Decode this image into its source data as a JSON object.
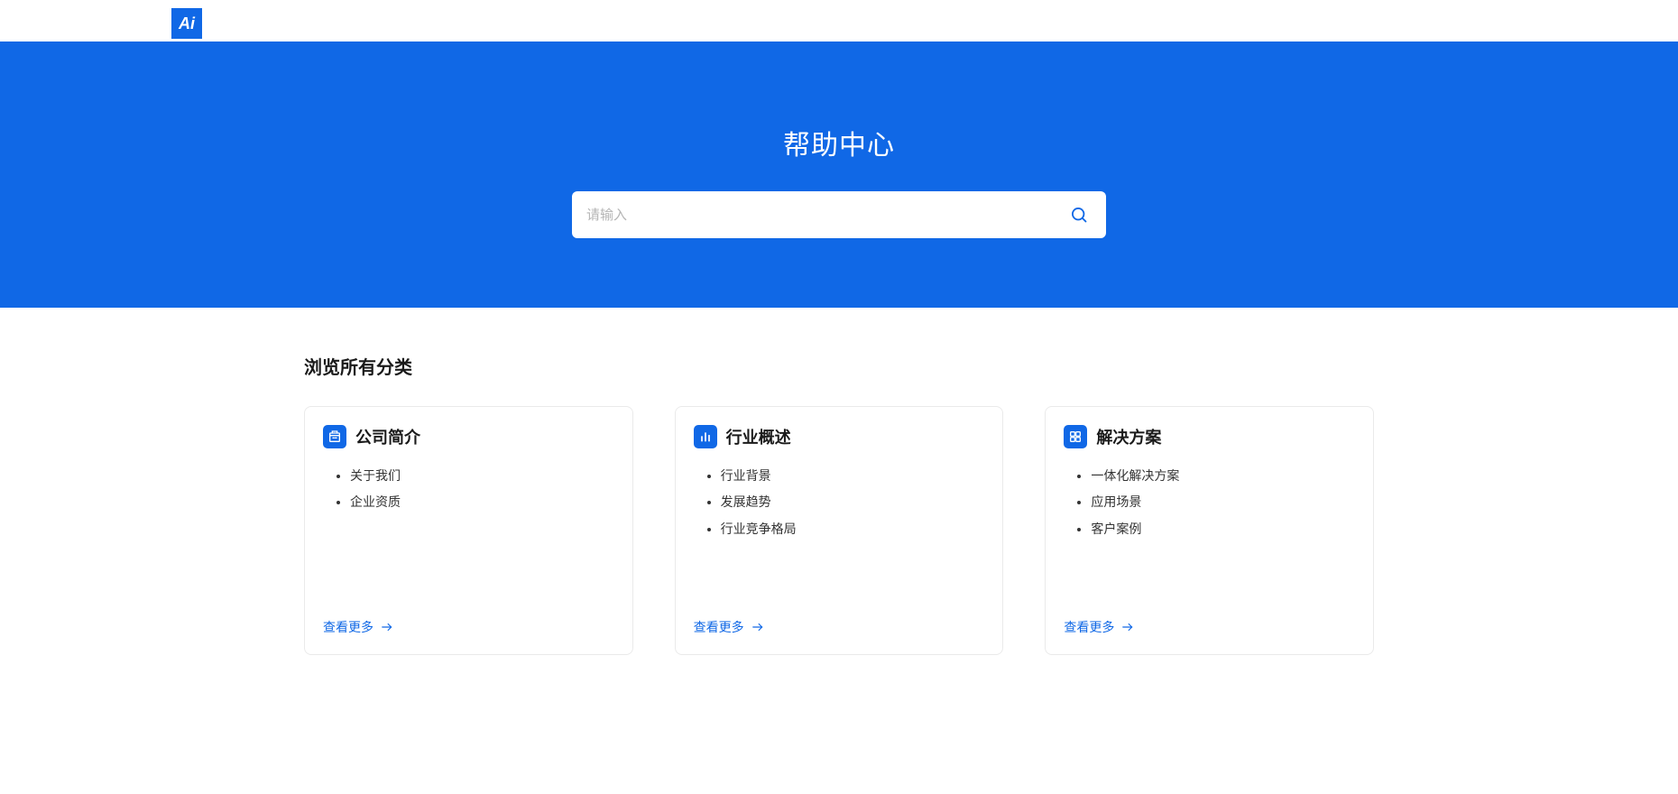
{
  "brand": {
    "logo_text": "Ai"
  },
  "hero": {
    "title": "帮助中心",
    "search_placeholder": "请输入"
  },
  "section_title": "浏览所有分类",
  "cards": [
    {
      "icon": "building-icon",
      "title": "公司简介",
      "items": [
        "关于我们",
        "企业资质"
      ],
      "more": "查看更多"
    },
    {
      "icon": "chart-icon",
      "title": "行业概述",
      "items": [
        "行业背景",
        "发展趋势",
        "行业竞争格局"
      ],
      "more": "查看更多"
    },
    {
      "icon": "grid-icon",
      "title": "解决方案",
      "items": [
        "一体化解决方案",
        "应用场景",
        "客户案例"
      ],
      "more": "查看更多"
    }
  ],
  "colors": {
    "primary": "#1068e6"
  }
}
